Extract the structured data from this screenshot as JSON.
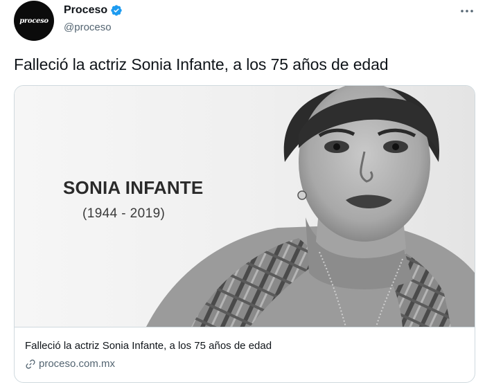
{
  "account": {
    "display_name": "Proceso",
    "handle": "@proceso",
    "avatar_text": "proceso",
    "verified": true
  },
  "tweet": {
    "text": "Falleció la actriz Sonia Infante, a los 75 años de edad"
  },
  "card": {
    "image": {
      "headline": "SONIA INFANTE",
      "years": "(1944 - 2019)",
      "subject": "black-and-white portrait of a woman in a turtleneck and plaid scarf"
    },
    "title": "Falleció la actriz Sonia Infante, a los 75 años de edad",
    "domain": "proceso.com.mx"
  },
  "icons": {
    "verified": "verified-badge-icon",
    "more": "more-options-icon",
    "link": "link-icon"
  },
  "colors": {
    "verified_blue": "#1d9bf0",
    "text_primary": "#0f1419",
    "text_secondary": "#536471",
    "border": "#cfd9de"
  }
}
